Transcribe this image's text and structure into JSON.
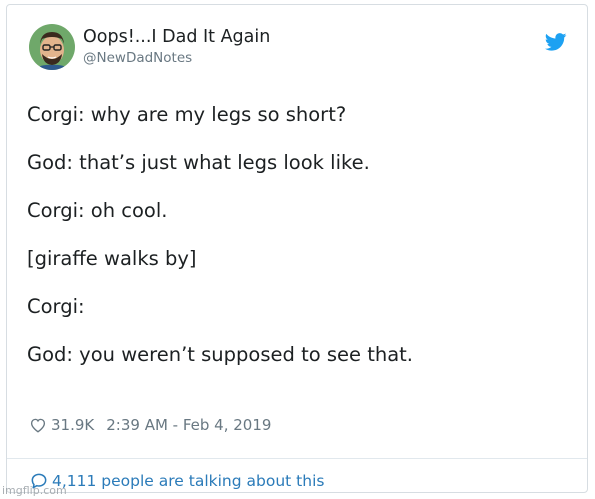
{
  "tweet": {
    "author_name": "Oops!...I Dad It Again",
    "handle": "@NewDadNotes",
    "lines": [
      "Corgi: why are my legs so short?",
      "",
      "God: that’s just what legs look like.",
      "",
      "Corgi: oh cool.",
      "",
      "[giraffe walks by]",
      "",
      "Corgi:",
      "",
      "God: you weren’t supposed to see that."
    ],
    "likes": "31.9K",
    "timestamp": "2:39 AM - Feb 4, 2019",
    "talking": "4,111 people are talking about this"
  },
  "icons": {
    "logo": "twitter-bird-icon",
    "like": "heart-icon",
    "reply": "speech-bubble-icon"
  },
  "colors": {
    "twitter_blue": "#1da1f2",
    "link_blue": "#2b7bb9",
    "muted": "#697882",
    "text": "#1c2022"
  },
  "watermark": "imgflip.com"
}
